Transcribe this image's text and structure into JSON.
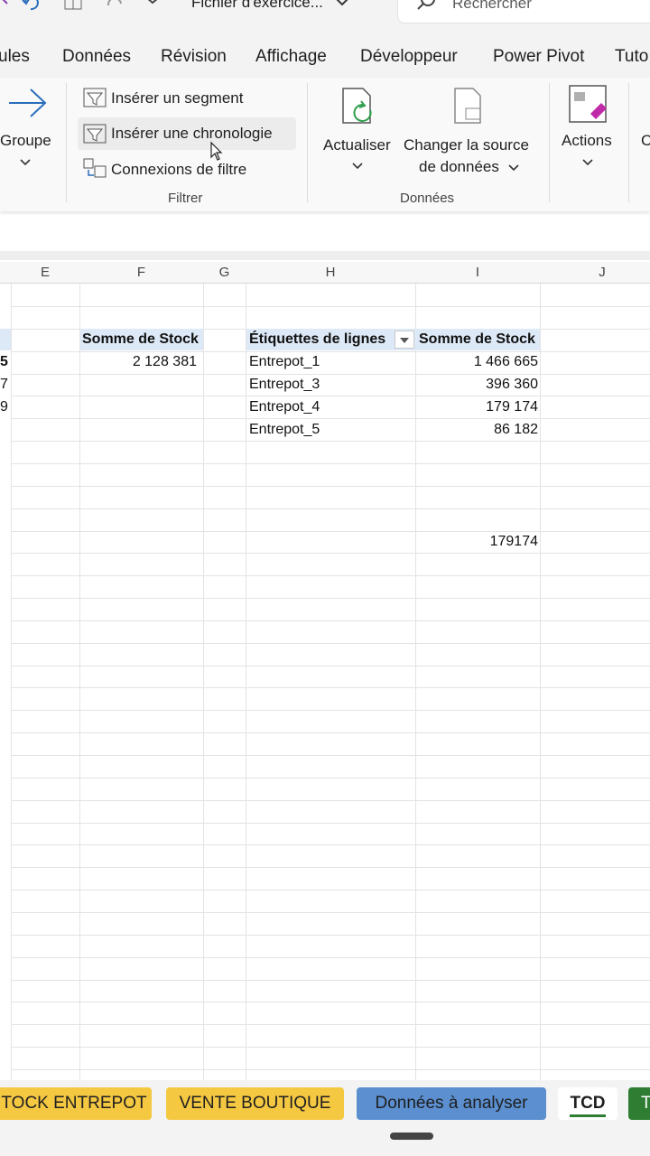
{
  "titlebar": {
    "file_title": "Fichier d'exercice...",
    "search_placeholder": "Rechercher"
  },
  "tabs": [
    "ules",
    "Données",
    "Révision",
    "Affichage",
    "Développeur",
    "Power Pivot",
    "Tuto"
  ],
  "ribbon": {
    "groupe_label": "Groupe",
    "filter_items": [
      "Insérer un segment",
      "Insérer une chronologie",
      "Connexions de filtre"
    ],
    "filter_caption": "Filtrer",
    "actualiser_label": "Actualiser",
    "changer_source_line1": "Changer la source",
    "changer_source_line2": "de données",
    "donnees_caption": "Données",
    "actions_label": "Actions",
    "next_partial": "C"
  },
  "grid": {
    "columns": [
      "E",
      "F",
      "G",
      "H",
      "I",
      "J"
    ],
    "left_partial_values": [
      "5",
      "7",
      "9"
    ],
    "f_header": "Somme de Stock",
    "f_value": "2 128 381",
    "pivot_header_rows": "Étiquettes de lignes",
    "pivot_header_values": "Somme de Stock",
    "pivot_rows": [
      {
        "label": "Entrepot_1",
        "value": "1 466 665"
      },
      {
        "label": "Entrepot_3",
        "value": "396 360"
      },
      {
        "label": "Entrepot_4",
        "value": "179 174"
      },
      {
        "label": "Entrepot_5",
        "value": "86 182"
      }
    ],
    "lookup_value": "179174"
  },
  "sheets": {
    "tabs": [
      {
        "label": "TOCK ENTREPOT",
        "color": "#f5c842"
      },
      {
        "label": "VENTE BOUTIQUE",
        "color": "#f5c842"
      },
      {
        "label": "Données à analyser",
        "color": "#5b8fd0"
      },
      {
        "label": "TCD",
        "color": "#ffffff",
        "active": true
      },
      {
        "label": "T",
        "color": "#2e7d32"
      }
    ]
  }
}
